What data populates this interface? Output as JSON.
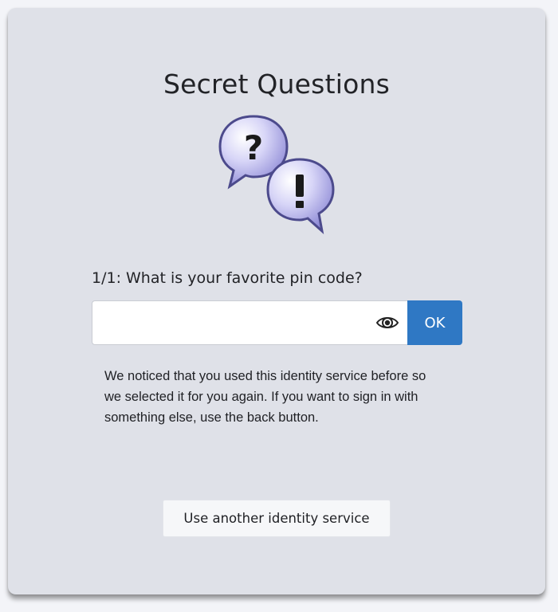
{
  "card": {
    "title": "Secret Questions",
    "question": {
      "label": "1/1: What is your favorite pin code?",
      "value": "",
      "placeholder": ""
    },
    "ok_label": "OK",
    "notice": "We noticed that you used this identity service before so we selected it for you again. If you want to sign in with something else, use the back button.",
    "alt_button_label": "Use another identity service"
  },
  "icons": {
    "illustration": "question-exclamation-speech-bubbles-icon",
    "reveal": "eye-icon"
  },
  "colors": {
    "card_background": "#dfe1e8",
    "primary_button": "#2f78c4",
    "bubble_fill": "#c8c6f2"
  }
}
